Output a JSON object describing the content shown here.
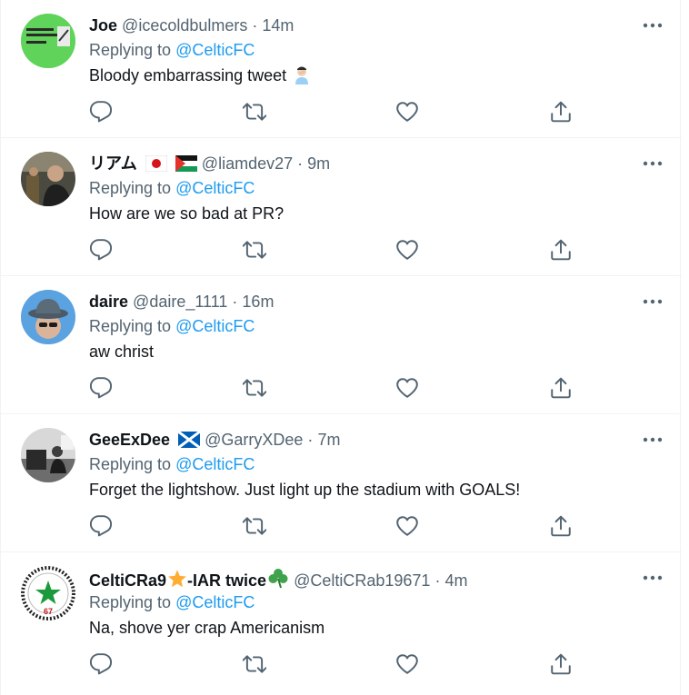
{
  "colors": {
    "link": "#1d9bf0",
    "secondary_text": "#536471",
    "primary_text": "#0f1419",
    "divider": "#eff3f4"
  },
  "reply_prefix": "Replying to",
  "tweets": [
    {
      "display_name": "Joe",
      "handle": "@icecoldbulmers",
      "separator": "·",
      "time": "14m",
      "replying_to": "@CelticFC",
      "text": "Bloody embarrassing tweet",
      "text_emoji": "person-facepalming-icon",
      "avatar": "green-meme-avatar"
    },
    {
      "display_name": "リアム",
      "display_name_flags": [
        "japan-flag-icon",
        "palestine-flag-icon"
      ],
      "handle": "@liamdev27",
      "separator": "·",
      "time": "9m",
      "replying_to": "@CelticFC",
      "text": "How are we so bad at PR?",
      "avatar": "photo-avatar"
    },
    {
      "display_name": "daire",
      "handle": "@daire_1111",
      "separator": "·",
      "time": "16m",
      "replying_to": "@CelticFC",
      "text": "aw christ",
      "avatar": "bucket-hat-avatar"
    },
    {
      "display_name": "GeeExDee",
      "display_name_flags": [
        "scotland-flag-icon"
      ],
      "handle": "@GarryXDee",
      "separator": "·",
      "time": "7m",
      "replying_to": "@CelticFC",
      "text": "Forget the lightshow. Just light up the stadium with GOALS!",
      "avatar": "bw-room-avatar"
    },
    {
      "display_name_part1": "CeltiCRa9",
      "display_name_part2": "-IAR twice",
      "display_name_emojis": [
        "star-icon",
        "shamrock-icon"
      ],
      "handle": "@CeltiCRab19671",
      "separator": "·",
      "time": "4m",
      "replying_to": "@CelticFC",
      "text": "Na, shove yer crap Americanism",
      "avatar_text": "67",
      "avatar": "celtic-star-badge-avatar"
    }
  ]
}
